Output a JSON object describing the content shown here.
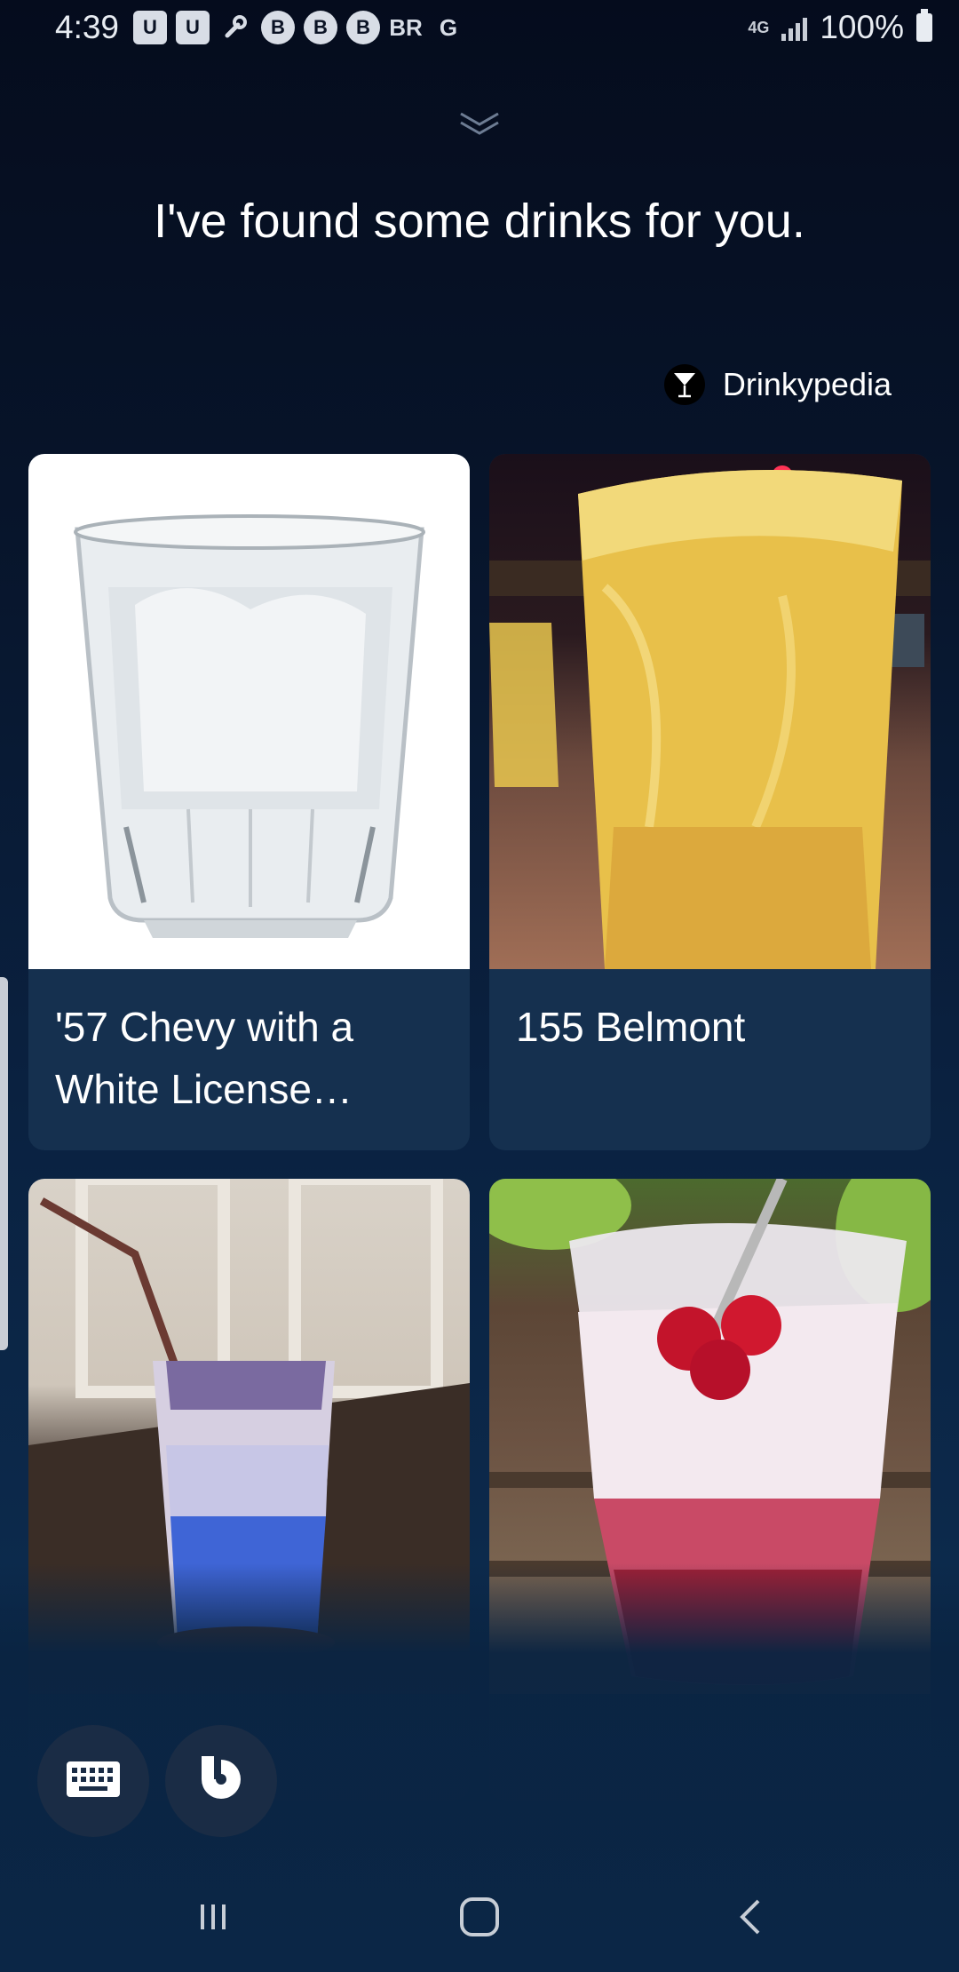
{
  "status_bar": {
    "time": "4:39",
    "notification_icons": [
      "U",
      "U",
      "wrench-icon",
      "B",
      "B",
      "B",
      "BR",
      "G"
    ],
    "network": "4G",
    "battery": "100%"
  },
  "assistant": {
    "message": "I've found some drinks for you."
  },
  "source": {
    "name": "Drinkypedia",
    "icon": "martini-icon"
  },
  "results": [
    {
      "name": "'57 Chevy with a White License…",
      "image": "clear-drink-glass"
    },
    {
      "name": "155 Belmont",
      "image": "orange-drink-glass"
    },
    {
      "name": "",
      "image": "blue-layered-drink"
    },
    {
      "name": "",
      "image": "cranberry-drink"
    }
  ],
  "bottom_controls": {
    "keyboard": "keyboard-icon",
    "bixby": "bixby-icon"
  },
  "nav_bar": {
    "recent": "recent-apps-icon",
    "home": "home-icon",
    "back": "back-icon"
  },
  "colors": {
    "card_bg": "#15304f",
    "accent": "#ffffff"
  }
}
